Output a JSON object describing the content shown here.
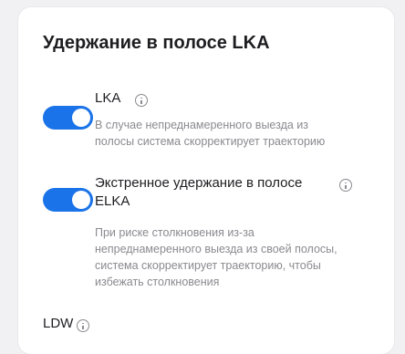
{
  "section": {
    "title": "Удержание в полосе LKA"
  },
  "lka": {
    "label": "LKA",
    "enabled": true,
    "description_lines": [
      "В случае непреднамеренного выезда из",
      "полосы система скорректирует траекторию"
    ]
  },
  "elka": {
    "label_line1": "Экстренное удержание в полосе",
    "label_line2": "ELKA",
    "enabled": true,
    "description_lines": [
      "При риске столкновения из-за",
      "непреднамеренного выезда из своей полосы,",
      "система скорректирует траекторию, чтобы",
      "избежать столкновения"
    ]
  },
  "ldw": {
    "label": "LDW"
  },
  "colors": {
    "accent": "#1a73e8",
    "text": "#1e1e22",
    "muted": "#8a8a90"
  },
  "icons": {
    "info": "info-circle-icon"
  }
}
